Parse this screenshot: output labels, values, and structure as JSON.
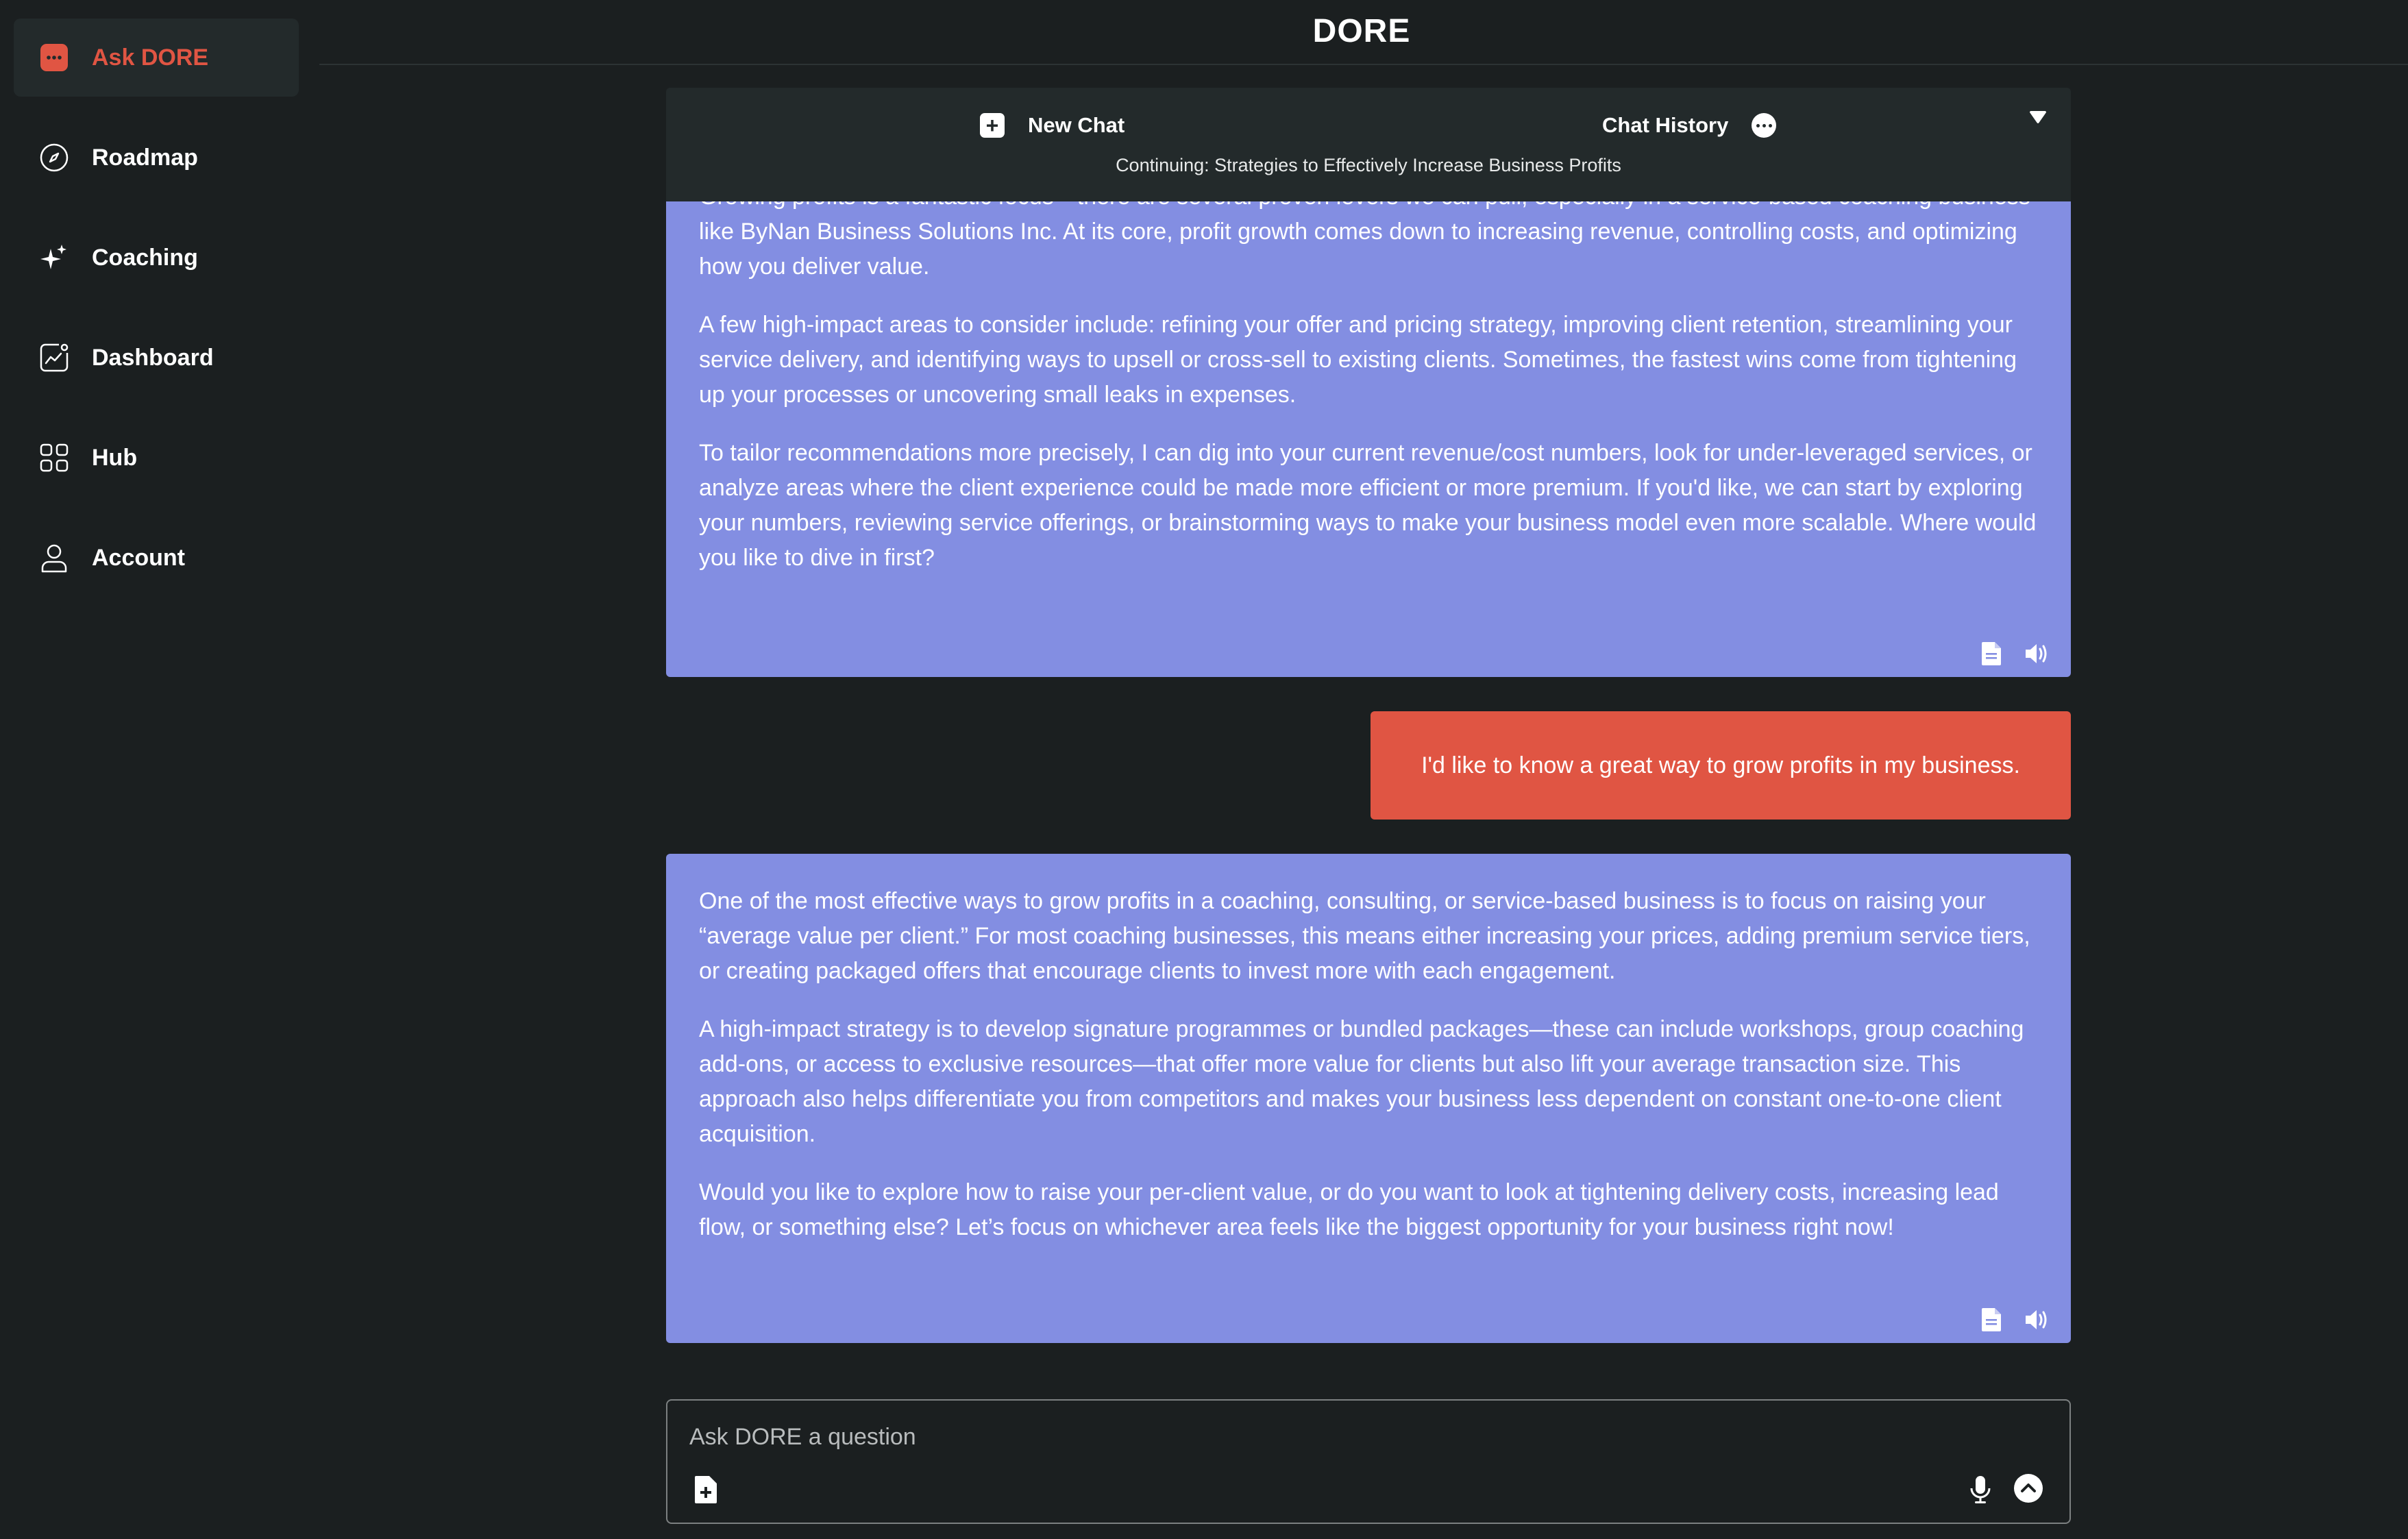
{
  "app": {
    "title": "DORE"
  },
  "sidebar": {
    "items": [
      {
        "label": "Ask DORE",
        "icon": "chat-bubble-icon",
        "active": true
      },
      {
        "label": "Roadmap",
        "icon": "compass-icon"
      },
      {
        "label": "Coaching",
        "icon": "sparkles-icon"
      },
      {
        "label": "Dashboard",
        "icon": "chart-icon"
      },
      {
        "label": "Hub",
        "icon": "grid-icon"
      },
      {
        "label": "Account",
        "icon": "user-icon"
      }
    ]
  },
  "toolbar": {
    "new_chat_label": "New Chat",
    "chat_history_label": "Chat History",
    "subtitle": "Continuing: Strategies to Effectively Increase Business Profits"
  },
  "messages": {
    "ai_first": {
      "p1": "Growing profits is a fantastic focus—there are several proven levers we can pull, especially in a service-based coaching business like ByNan Business Solutions Inc. At its core, profit growth comes down to increasing revenue, controlling costs, and optimizing how you deliver value.",
      "p2": "A few high-impact areas to consider include: refining your offer and pricing strategy, improving client retention, streamlining your service delivery, and identifying ways to upsell or cross-sell to existing clients. Sometimes, the fastest wins come from tightening up your processes or uncovering small leaks in expenses.",
      "p3": "To tailor recommendations more precisely, I can dig into your current revenue/cost numbers, look for under-leveraged services, or analyze areas where the client experience could be made more efficient or more premium. If you'd like, we can start by exploring your numbers, reviewing service offerings, or brainstorming ways to make your business model even more scalable. Where would you like to dive in first?"
    },
    "user": {
      "text": "I'd like to know a great way to grow profits in my business."
    },
    "ai_second": {
      "p1": "One of the most effective ways to grow profits in a coaching, consulting, or service-based business is to focus on raising your “average value per client.” For most coaching businesses, this means either increasing your prices, adding premium service tiers, or creating packaged offers that encourage clients to invest more with each engagement.",
      "p2": "A high-impact strategy is to develop signature programmes or bundled packages—these can include workshops, group coaching add-ons, or access to exclusive resources—that offer more value for clients but also lift your average transaction size. This approach also helps differentiate you from competitors and makes your business less dependent on constant one-to-one client acquisition.",
      "p3": "Would you like to explore how to raise your per-client value, or do you want to look at tightening delivery costs, increasing lead flow, or something else? Let’s focus on whichever area feels like the biggest opportunity for your business right now!"
    }
  },
  "input": {
    "placeholder": "Ask DORE a question",
    "value": ""
  },
  "colors": {
    "background": "#1b1f20",
    "panel": "#232a2b",
    "accent": "#e05543",
    "ai_bubble": "#838ee2"
  }
}
